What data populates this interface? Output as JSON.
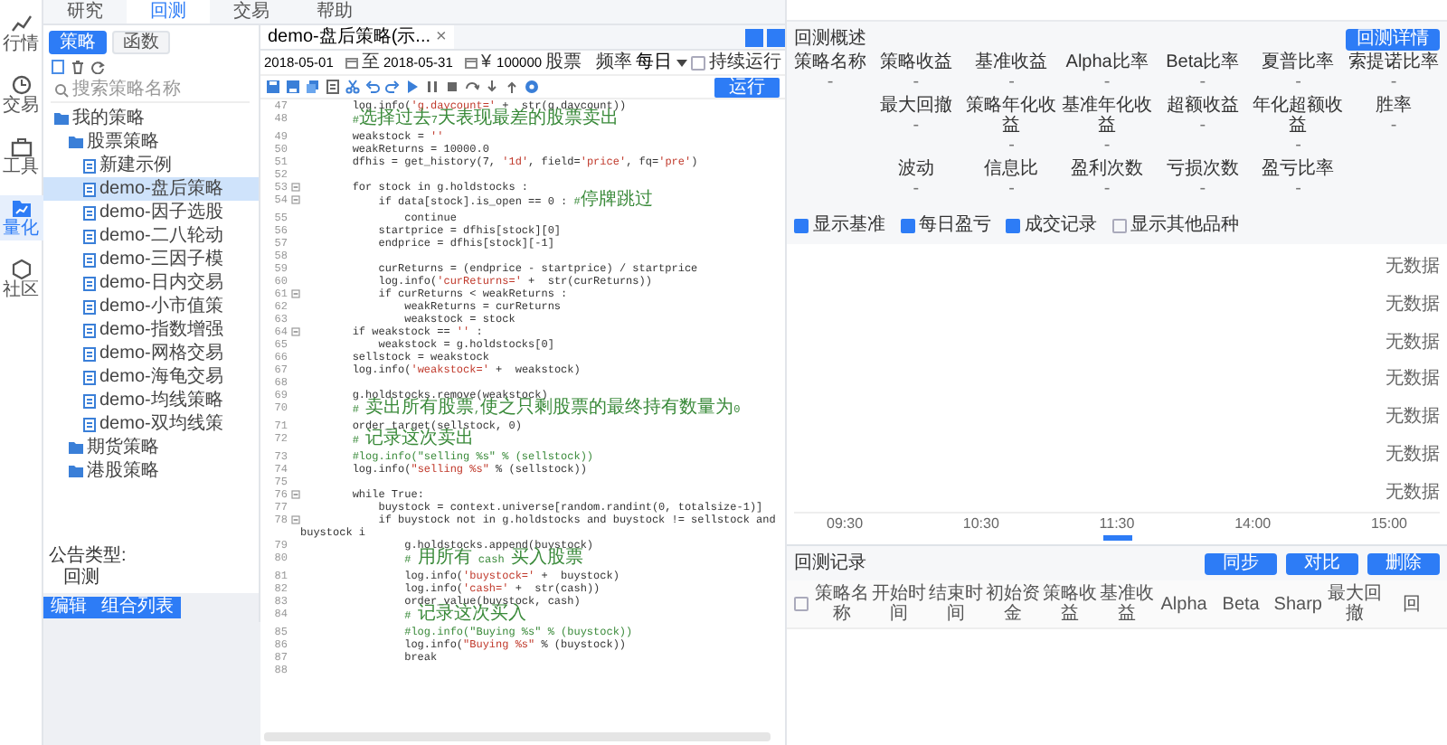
{
  "app_rail": [
    {
      "kind": "chart",
      "label": "行情",
      "selected": false
    },
    {
      "kind": "clock",
      "label": "交易",
      "selected": false
    },
    {
      "kind": "toolbox",
      "label": "工具",
      "selected": false
    },
    {
      "kind": "quant",
      "label": "量化",
      "selected": true
    },
    {
      "kind": "community",
      "label": "社区",
      "selected": false
    }
  ],
  "top_tabs": [
    {
      "label": "研究",
      "selected": false
    },
    {
      "label": "回测",
      "selected": true
    },
    {
      "label": "交易",
      "selected": false
    },
    {
      "label": "帮助",
      "selected": false
    }
  ],
  "strategy_panel": {
    "tabs": [
      {
        "label": "策略",
        "selected": true
      },
      {
        "label": "函数",
        "selected": false
      }
    ],
    "search": {
      "placeholder": "搜索策略名称"
    },
    "tree": [
      {
        "kind": "folder",
        "label": "我的策略",
        "selected": false,
        "children": [
          {
            "kind": "folder",
            "label": "股票策略",
            "selected": false,
            "children": [
              {
                "kind": "file",
                "label": "新建示例",
                "selected": false
              },
              {
                "kind": "file",
                "label": "demo-盘后策略",
                "selected": true
              },
              {
                "kind": "file",
                "label": "demo-因子选股",
                "selected": false
              },
              {
                "kind": "file",
                "label": "demo-二八轮动",
                "selected": false
              },
              {
                "kind": "file",
                "label": "demo-三因子模",
                "selected": false
              },
              {
                "kind": "file",
                "label": "demo-日内交易",
                "selected": false
              },
              {
                "kind": "file",
                "label": "demo-小市值策",
                "selected": false
              },
              {
                "kind": "file",
                "label": "demo-指数增强",
                "selected": false
              },
              {
                "kind": "file",
                "label": "demo-网格交易",
                "selected": false
              },
              {
                "kind": "file",
                "label": "demo-海龟交易",
                "selected": false
              },
              {
                "kind": "file",
                "label": "demo-均线策略",
                "selected": false
              },
              {
                "kind": "file",
                "label": "demo-双均线策",
                "selected": false
              }
            ]
          },
          {
            "kind": "folder",
            "label": "期货策略",
            "selected": false
          },
          {
            "kind": "folder",
            "label": "港股策略",
            "selected": false
          }
        ]
      }
    ],
    "notice": {
      "label": "公告类型:",
      "value": "回测"
    },
    "buttons": [
      "编辑",
      "组合列表"
    ]
  },
  "editor": {
    "tab": {
      "label": "demo-盘后策略(示...",
      "close": "×"
    },
    "settings": {
      "start_date": "2018-05-01",
      "separator": "至",
      "end_date": "2018-05-31",
      "currency": "¥",
      "capital": "100000",
      "market": "股票",
      "frequency_label": "频率",
      "frequency": "每日",
      "continuous": {
        "label": "持续运行",
        "checked": false
      }
    },
    "run_button": "运行",
    "code": [
      {
        "n": "47",
        "text": "        log.info('g.daycount=' +  str(g.daycount))",
        "fold": false
      },
      {
        "n": "48",
        "text": "        #选择过去7天表现最差的股票卖出",
        "fold": false
      },
      {
        "n": "49",
        "text": "        weakstock = ''",
        "fold": false
      },
      {
        "n": "50",
        "text": "        weakReturns = 10000.0",
        "fold": false
      },
      {
        "n": "51",
        "text": "        dfhis = get_history(7, '1d', field='price', fq='pre')",
        "fold": false
      },
      {
        "n": "52",
        "fold": false
      },
      {
        "n": "53",
        "text": "        for stock in g.holdstocks :",
        "fold": true
      },
      {
        "n": "54",
        "text": "            if data[stock].is_open == 0 : #停牌跳过",
        "fold": true
      },
      {
        "n": "55",
        "text": "                continue",
        "fold": false
      },
      {
        "n": "56",
        "text": "            startprice = dfhis[stock][0]",
        "fold": false
      },
      {
        "n": "57",
        "text": "            endprice = dfhis[stock][-1]",
        "fold": false
      },
      {
        "n": "58",
        "fold": false
      },
      {
        "n": "59",
        "text": "            curReturns = (endprice - startprice) / startprice",
        "fold": false
      },
      {
        "n": "60",
        "text": "            log.info('curReturns=' +  str(curReturns))",
        "fold": false
      },
      {
        "n": "61",
        "text": "            if curReturns < weakReturns :",
        "fold": true
      },
      {
        "n": "62",
        "text": "                weakReturns = curReturns",
        "fold": false
      },
      {
        "n": "63",
        "text": "                weakstock = stock",
        "fold": false
      },
      {
        "n": "64",
        "text": "        if weakstock == '' :",
        "fold": true
      },
      {
        "n": "65",
        "text": "            weakstock = g.holdstocks[0]",
        "fold": false
      },
      {
        "n": "66",
        "text": "        sellstock = weakstock",
        "fold": false
      },
      {
        "n": "67",
        "text": "        log.info('weakstock=' +  weakstock)",
        "fold": false
      },
      {
        "n": "68",
        "fold": false
      },
      {
        "n": "69",
        "text": "        g.holdstocks.remove(weakstock)",
        "fold": false
      },
      {
        "n": "70",
        "text": "        # 卖出所有股票,使之只剩股票的最终持有数量为0",
        "fold": false
      },
      {
        "n": "71",
        "text": "        order_target(sellstock, 0)",
        "fold": false
      },
      {
        "n": "72",
        "text": "        # 记录这次卖出",
        "fold": false
      },
      {
        "n": "73",
        "text": "        #log.info(\"selling %s\" % (sellstock))",
        "fold": false
      },
      {
        "n": "74",
        "text": "        log.info(\"selling %s\" % (sellstock))",
        "fold": false
      },
      {
        "n": "75",
        "fold": false
      },
      {
        "n": "76",
        "text": "        while True:",
        "fold": true
      },
      {
        "n": "77",
        "text": "            buystock = context.universe[random.randint(0, totalsize-1)]",
        "fold": false
      },
      {
        "n": "78",
        "text": "            if buystock not in g.holdstocks and buystock != sellstock and buystock i",
        "fold": true
      },
      {
        "n": "79",
        "text": "                g.holdstocks.append(buystock)",
        "fold": false
      },
      {
        "n": "80",
        "text": "                # 用所有 cash 买入股票",
        "fold": false
      },
      {
        "n": "81",
        "text": "                log.info('buystock=' +  buystock)",
        "fold": false
      },
      {
        "n": "82",
        "text": "                log.info('cash=' +  str(cash))",
        "fold": false
      },
      {
        "n": "83",
        "text": "                order_value(buystock, cash)",
        "fold": false
      },
      {
        "n": "84",
        "text": "                # 记录这次买入",
        "fold": false
      },
      {
        "n": "85",
        "text": "                #log.info(\"Buying %s\" % (buystock))",
        "fold": false
      },
      {
        "n": "86",
        "text": "                log.info(\"Buying %s\" % (buystock))",
        "fold": false
      },
      {
        "n": "87",
        "text": "                break",
        "fold": false
      },
      {
        "n": "88",
        "fold": false
      }
    ]
  },
  "overview": {
    "title": "回测概述",
    "detail_button": "回测详情",
    "strategy_name": {
      "label": "策略名称",
      "value": "-"
    },
    "metrics": [
      [
        {
          "label": "策略收益",
          "value": "-"
        },
        {
          "label": "基准收益",
          "value": "-"
        },
        {
          "label": "Alpha比率",
          "value": "-"
        },
        {
          "label": "Beta比率",
          "value": "-"
        },
        {
          "label": "夏普比率",
          "value": "-"
        },
        {
          "label": "索提诺比率",
          "value": "-"
        }
      ],
      [
        {
          "label": "最大回撤",
          "value": "-"
        },
        {
          "label": "策略年化收益",
          "value": "-"
        },
        {
          "label": "基准年化收益",
          "value": "-"
        },
        {
          "label": "超额收益",
          "value": "-"
        },
        {
          "label": "年化超额收益",
          "value": "-"
        },
        {
          "label": "胜率",
          "value": "-"
        }
      ],
      [
        {
          "label": "波动",
          "value": "-"
        },
        {
          "label": "信息比",
          "value": "-"
        },
        {
          "label": "盈利次数",
          "value": "-"
        },
        {
          "label": "亏损次数",
          "value": "-"
        },
        {
          "label": "盈亏比率",
          "value": "-"
        }
      ]
    ],
    "options": [
      {
        "label": "显示基准",
        "checked": true
      },
      {
        "label": "每日盈亏",
        "checked": true
      },
      {
        "label": "成交记录",
        "checked": true
      },
      {
        "label": "显示其他品种",
        "checked": false
      }
    ],
    "chart": {
      "no_data_labels": [
        "无数据",
        "无数据",
        "无数据",
        "无数据",
        "无数据",
        "无数据",
        "无数据"
      ],
      "x_labels": [
        "09:30",
        "10:30",
        "11:30",
        "14:00",
        "15:00"
      ]
    }
  },
  "records": {
    "title": "回测记录",
    "buttons": [
      "同步",
      "对比",
      "删除"
    ],
    "select_all": {
      "checked": false
    },
    "columns": [
      "策略名称",
      "开始时间",
      "结束时间",
      "初始资金",
      "策略收益",
      "基准收益",
      "Alpha",
      "Beta",
      "Sharp",
      "最大回撤",
      "回"
    ]
  }
}
